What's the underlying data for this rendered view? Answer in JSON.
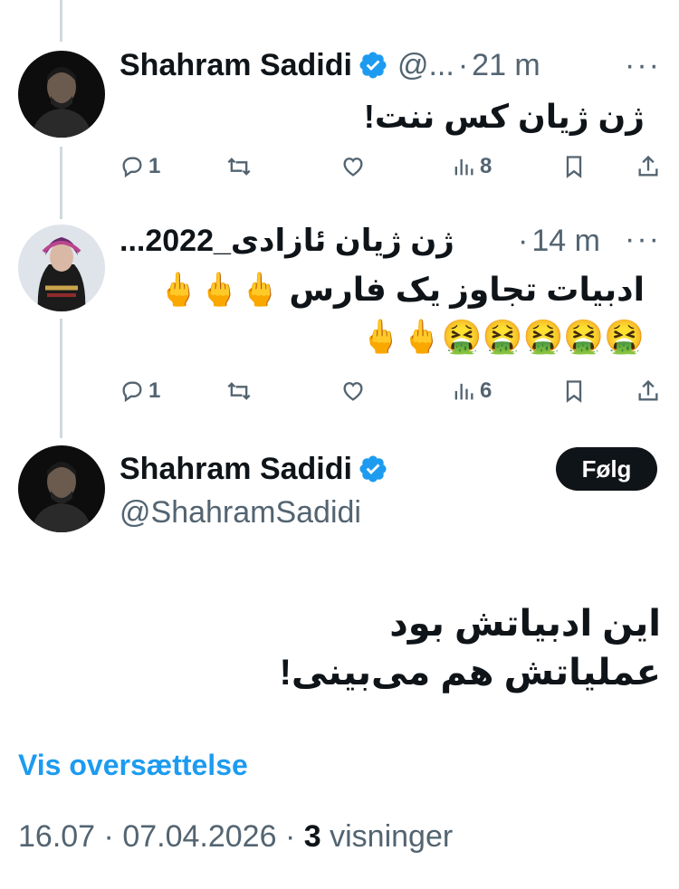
{
  "tweet1": {
    "name": "Shahram Sadidi",
    "handle": "@...",
    "sep": "·",
    "time": "21 m",
    "more": "···",
    "text": "ژن ژیان کس ننت!",
    "actions": {
      "reply": "1",
      "retweet": "",
      "like": "",
      "views": "8"
    }
  },
  "tweet2": {
    "name": "ژن ژیان ئازادی_2022...",
    "sep": "·",
    "time": "14 m",
    "more": "···",
    "line1": "ادبیات تجاوز یک فارس 🖕🖕🖕",
    "line2": "🤮🤮🤮🤮🤮🖕🖕",
    "actions": {
      "reply": "1",
      "retweet": "",
      "like": "",
      "views": "6"
    }
  },
  "main": {
    "name": "Shahram Sadidi",
    "handle": "@ShahramSadidi",
    "follow_label": "Følg",
    "line1": "این ادبیاتش بود",
    "line2": "عملیاتش هم می‌بینی!",
    "translate": "Vis oversættelse",
    "time": "16.07",
    "sep1": "·",
    "date": "07.04.2026",
    "sep2": "·",
    "views_count": "3",
    "views_label": "visninger"
  },
  "colors": {
    "accent": "#1d9bf0",
    "text": "#0f1419",
    "muted": "#536471",
    "line": "#cfd9de"
  },
  "icons": [
    "verified-badge-icon",
    "more-icon",
    "reply-icon",
    "retweet-icon",
    "like-icon",
    "views-icon",
    "bookmark-icon",
    "share-icon"
  ]
}
